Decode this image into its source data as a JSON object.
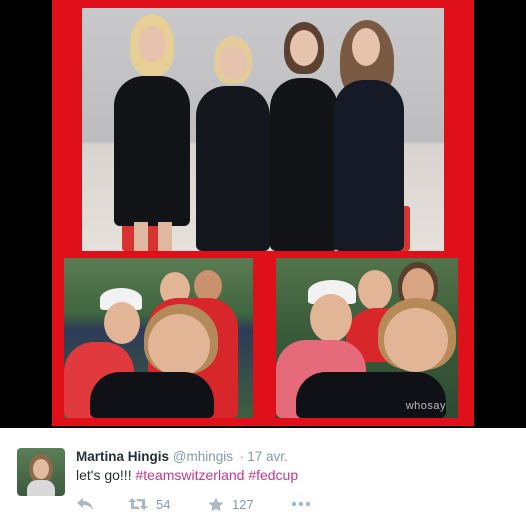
{
  "media": {
    "watermark": "whosay"
  },
  "tweet": {
    "fullname": "Martina Hingis",
    "handle": "@mhingis",
    "separator": "·",
    "date": "17 avr.",
    "text_plain": "let's go!!!",
    "hashtags": [
      "#teamswitzerland",
      "#fedcup"
    ],
    "actions": {
      "reply_icon": "reply-icon",
      "retweet_icon": "retweet-icon",
      "retweet_count": "54",
      "favorite_icon": "star-icon",
      "favorite_count": "127",
      "more_icon": "more-icon"
    }
  },
  "colors": {
    "collage_red": "#e0101a",
    "hashtag": "#c03a8f",
    "name": "#292f33",
    "meta": "#8899a6",
    "action": "#aab8c2"
  }
}
